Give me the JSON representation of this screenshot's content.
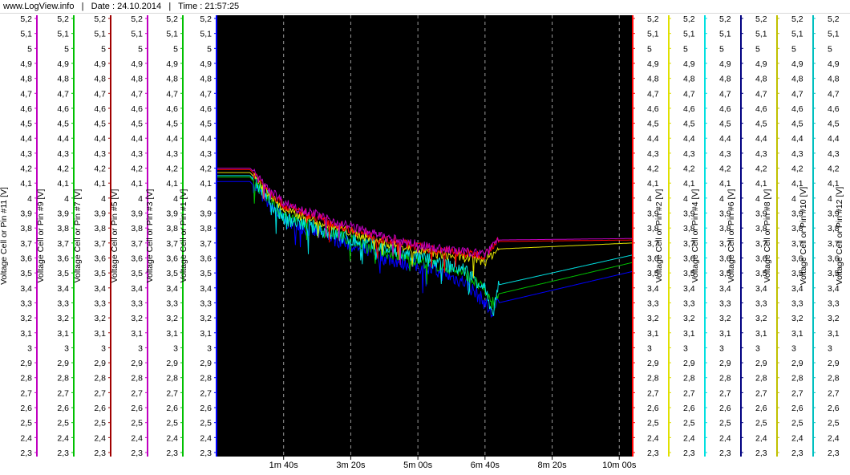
{
  "header": {
    "site": "www.LogView.info",
    "separator": "|",
    "date": "Date : 24.10.2014",
    "time": "Time : 21:57:25"
  },
  "chart_data": {
    "type": "line",
    "background": "#000000",
    "grid": "vertical dashed",
    "x_ticks": [
      "1m 40s",
      "3m 20s",
      "5m 00s",
      "6m 40s",
      "8m 20s",
      "10m 00s"
    ],
    "x_range_s": [
      0,
      620
    ],
    "y_range": [
      2.3,
      5.2
    ],
    "y_ticks": [
      "5,2",
      "5,1",
      "5",
      "4,9",
      "4,8",
      "4,7",
      "4,6",
      "4,5",
      "4,4",
      "4,3",
      "4,2",
      "4,1",
      "4",
      "3,9",
      "3,8",
      "3,7",
      "3,6",
      "3,5",
      "3,4",
      "3,3",
      "3,2",
      "3,1",
      "3",
      "2,9",
      "2,8",
      "2,7",
      "2,6",
      "2,5",
      "2,4",
      "2,3"
    ],
    "axes_left": [
      {
        "label": "Voltage Cell or Pin #11 [V]",
        "color": "#c000c0"
      },
      {
        "label": "Voltage Cell or Pin #9 [V]",
        "color": "#00c000"
      },
      {
        "label": "Voltage Cell or Pin #7 [V]",
        "color": "#a00000"
      },
      {
        "label": "Voltage Cell or Pin #5 [V]",
        "color": "#c000c0"
      },
      {
        "label": "Voltage Cell or Pin #3 [V]",
        "color": "#00c000"
      },
      {
        "label": "Voltage Cell or Pin #1 [V]",
        "color": "#0000ff"
      }
    ],
    "axes_right": [
      {
        "label": "Voltage Cell or Pin #2 [V]",
        "color": "#ff0000"
      },
      {
        "label": "Voltage Cell or Pin #4 [V]",
        "color": "#e0e000"
      },
      {
        "label": "Voltage Cell or Pin #6 [V]",
        "color": "#00e0e0"
      },
      {
        "label": "Voltage Cell or Pin #8 [V]",
        "color": "#000080"
      },
      {
        "label": "Voltage Cell or Pin #10 [V]",
        "color": "#c0c000"
      },
      {
        "label": "Voltage Cell or Pin #12 [V]",
        "color": "#00c0c0"
      }
    ],
    "series": [
      {
        "color": "#0000ff",
        "start": 4.11,
        "end": 3.51,
        "noise": 0.05,
        "x": [
          0,
          50,
          100,
          180,
          250,
          320,
          370,
          400,
          410,
          420,
          620
        ],
        "y": [
          4.11,
          4.11,
          3.85,
          3.72,
          3.6,
          3.52,
          3.44,
          3.3,
          3.22,
          3.3,
          3.51
        ]
      },
      {
        "color": "#00c000",
        "start": 4.14,
        "end": 3.57,
        "noise": 0.04,
        "x": [
          0,
          50,
          100,
          180,
          250,
          320,
          370,
          400,
          410,
          420,
          620
        ],
        "y": [
          4.14,
          4.14,
          3.88,
          3.76,
          3.64,
          3.56,
          3.5,
          3.38,
          3.3,
          3.36,
          3.57
        ]
      },
      {
        "color": "#00e0e0",
        "start": 4.15,
        "end": 3.62,
        "noise": 0.05,
        "x": [
          0,
          50,
          100,
          180,
          250,
          320,
          370,
          400,
          410,
          420,
          620
        ],
        "y": [
          4.15,
          4.15,
          3.87,
          3.75,
          3.66,
          3.58,
          3.52,
          3.4,
          3.2,
          3.42,
          3.62
        ]
      },
      {
        "color": "#e0e000",
        "start": 4.17,
        "end": 3.7,
        "noise": 0.03,
        "x": [
          0,
          50,
          100,
          180,
          250,
          320,
          370,
          400,
          410,
          420,
          620
        ],
        "y": [
          4.17,
          4.17,
          3.92,
          3.8,
          3.7,
          3.63,
          3.6,
          3.58,
          3.62,
          3.66,
          3.7
        ]
      },
      {
        "color": "#ff0000",
        "start": 4.19,
        "end": 3.72,
        "noise": 0.03,
        "x": [
          0,
          50,
          100,
          180,
          250,
          320,
          370,
          400,
          410,
          420,
          620
        ],
        "y": [
          4.19,
          4.19,
          3.95,
          3.82,
          3.72,
          3.66,
          3.63,
          3.62,
          3.68,
          3.71,
          3.72
        ]
      },
      {
        "color": "#c000c0",
        "start": 4.2,
        "end": 3.73,
        "noise": 0.03,
        "x": [
          0,
          50,
          100,
          180,
          250,
          320,
          370,
          400,
          410,
          420,
          620
        ],
        "y": [
          4.2,
          4.2,
          3.97,
          3.84,
          3.74,
          3.67,
          3.64,
          3.63,
          3.69,
          3.72,
          3.73
        ]
      }
    ]
  }
}
